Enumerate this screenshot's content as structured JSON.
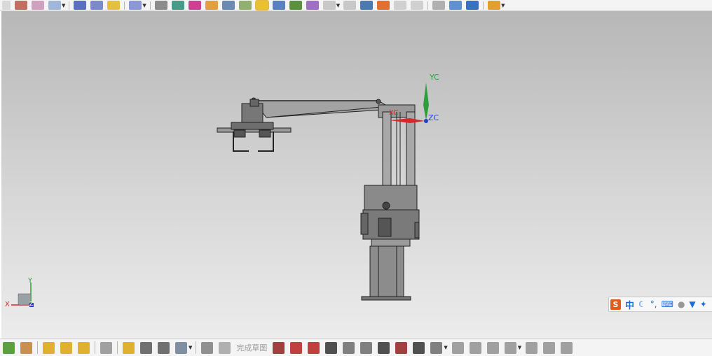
{
  "toolbar_top": {
    "icons": [
      "point-icon",
      "spline-icon",
      "extrude-icon",
      "revolve-icon",
      "cylinder-icon",
      "spring-icon",
      "coil-icon",
      "helix-icon",
      "print-icon",
      "measure-icon",
      "paint-icon",
      "material-icon",
      "shaded-view-icon",
      "wireframe-icon",
      "shaded-box-icon",
      "cylinder-view-icon",
      "render-icon",
      "texture-icon",
      "view-cube-icon",
      "layer-icon",
      "section-icon",
      "image-icon",
      "sheet-icon",
      "box-view-icon",
      "fit-icon",
      "orient-icon",
      "render-scene-icon"
    ]
  },
  "toolbar_bottom": {
    "icons": [
      "sketch-icon",
      "constraint-icon",
      "assembly-icon",
      "component-icon",
      "part-icon",
      "chain-icon",
      "link-icon",
      "joint-icon",
      "cube-view-icon",
      "sketch-finish-icon",
      "flag-icon"
    ],
    "finish_sketch_label": "完成草图",
    "sketch_tools": [
      "profile-icon",
      "line-icon",
      "arc-icon",
      "circle-icon",
      "fillet-icon",
      "chamfer-icon",
      "rectangle-icon",
      "polygon-icon",
      "plus-icon",
      "shape-icon",
      "trim-icon",
      "extend-icon",
      "offset-icon",
      "mirror-icon",
      "pattern-icon",
      "parallel-icon",
      "dimension-icon",
      "angle-icon"
    ]
  },
  "viewport": {
    "wcs_labels": {
      "yc": "YC",
      "zc": "ZC",
      "xc": "XC"
    },
    "triad_labels": {
      "x": "X",
      "y": "Y",
      "z": "Z"
    }
  },
  "ime_bar": {
    "logo": "S",
    "mode": "中",
    "icons": [
      "moon-icon",
      "punctuation-icon",
      "keyboard-icon",
      "user-icon",
      "shirt-icon",
      "settings-icon"
    ],
    "punctuation": "°,",
    "keyboard": "⌨"
  }
}
